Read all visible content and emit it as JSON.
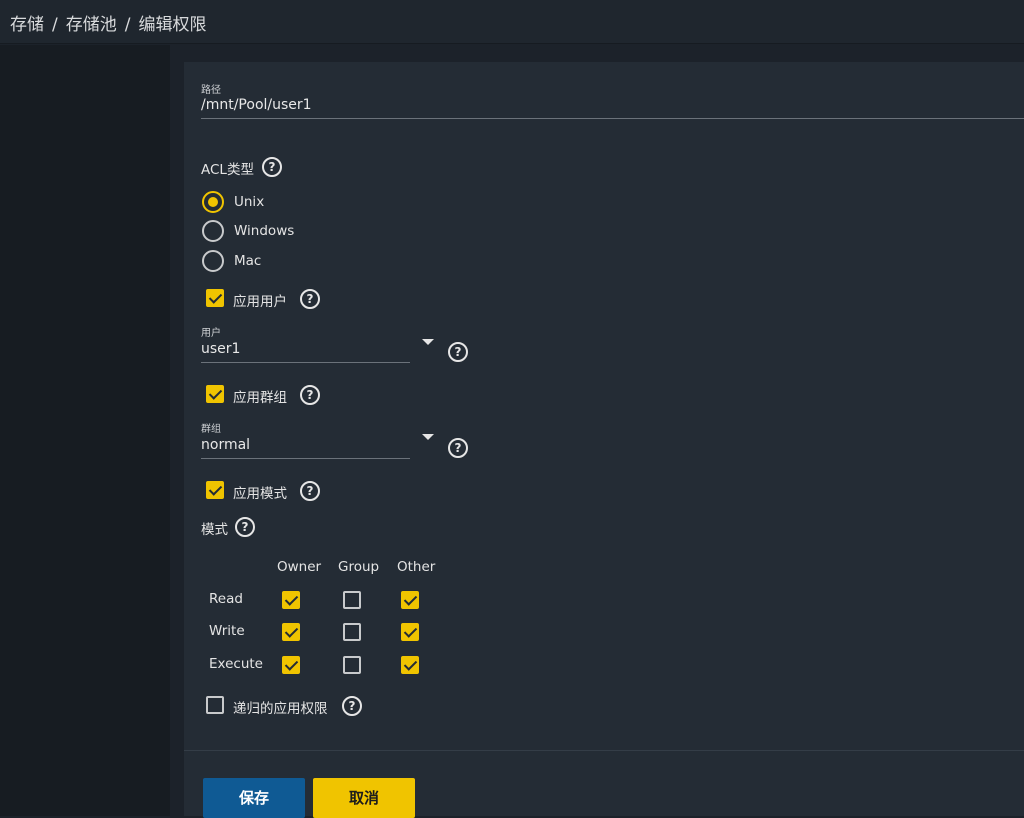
{
  "breadcrumb": {
    "items": [
      "存储",
      "存储池",
      "编辑权限"
    ],
    "separator": "/"
  },
  "path": {
    "label": "路径",
    "value": "/mnt/Pool/user1"
  },
  "acl_type": {
    "label": "ACL类型",
    "options": [
      "Unix",
      "Windows",
      "Mac"
    ],
    "selected": "Unix"
  },
  "apply_user": {
    "label": "应用用户",
    "checked": true
  },
  "user": {
    "label": "用户",
    "value": "user1"
  },
  "apply_group": {
    "label": "应用群组",
    "checked": true
  },
  "group": {
    "label": "群组",
    "value": "normal"
  },
  "apply_mode": {
    "label": "应用模式",
    "checked": true
  },
  "mode": {
    "label": "模式",
    "columns": [
      "Owner",
      "Group",
      "Other"
    ],
    "rows": [
      {
        "name": "Read",
        "values": [
          true,
          false,
          true
        ]
      },
      {
        "name": "Write",
        "values": [
          true,
          false,
          true
        ]
      },
      {
        "name": "Execute",
        "values": [
          true,
          false,
          true
        ]
      }
    ]
  },
  "recursive": {
    "label": "递归的应用权限",
    "checked": false
  },
  "buttons": {
    "save": "保存",
    "cancel": "取消"
  },
  "help_glyph": "?",
  "colors": {
    "accent": "#f0c400",
    "primary_button": "#0f5a94",
    "card": "#242c35",
    "background": "#1c222a"
  }
}
